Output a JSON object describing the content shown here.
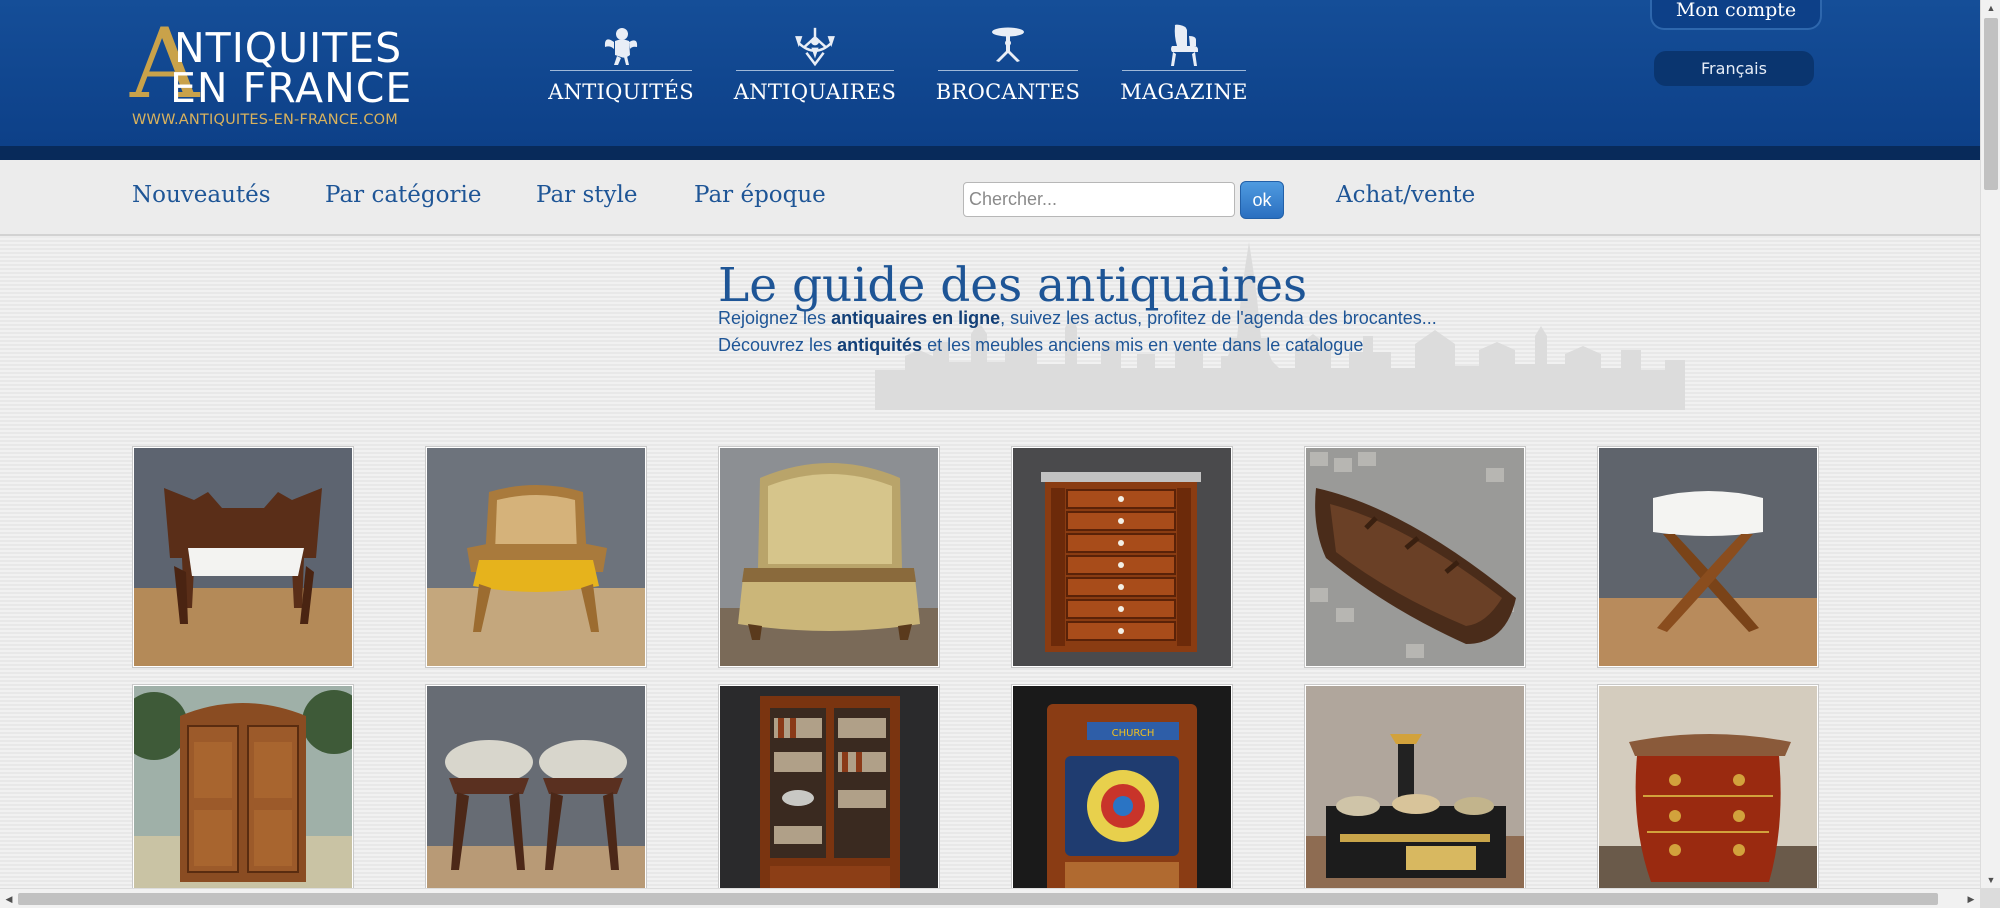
{
  "logo": {
    "line1": "NTIQUITES",
    "line2": "EN FRANCE",
    "big_letter": "A",
    "url": "WWW.ANTIQUITES-EN-FRANCE.COM"
  },
  "main_nav": [
    {
      "label": "ANTIQUITÉS",
      "icon": "cherub-icon"
    },
    {
      "label": "ANTIQUAIRES",
      "icon": "chandelier-icon"
    },
    {
      "label": "BROCANTES",
      "icon": "gueridon-icon"
    },
    {
      "label": "MAGAZINE",
      "icon": "armchair-icon"
    }
  ],
  "account": {
    "label": "Mon compte"
  },
  "language": {
    "label": "Français"
  },
  "subnav": {
    "links": [
      "Nouveautés",
      "Par catégorie",
      "Par style",
      "Par époque"
    ],
    "search_placeholder": "Chercher...",
    "search_button": "ok",
    "trade_link": "Achat/vente"
  },
  "guide": {
    "title": "Le guide des antiquaires",
    "line1": {
      "before": "Rejoignez les ",
      "bold": "antiquaires en ligne",
      "after": ", suivez les actus, profitez de l'agenda des brocantes..."
    },
    "line2": {
      "before": "Découvrez les ",
      "bold": "antiquités",
      "after": " et les meubles anciens mis en vente dans le catalogue"
    }
  },
  "products": [
    {
      "name": "carved-corner-chair",
      "subject": "corner chair"
    },
    {
      "name": "caned-armchair",
      "subject": "armchair"
    },
    {
      "name": "upholstered-bed",
      "subject": "bed"
    },
    {
      "name": "mahogany-chest-of-drawers",
      "subject": "chest"
    },
    {
      "name": "wooden-boat",
      "subject": "boat"
    },
    {
      "name": "curule-stool",
      "subject": "stool"
    },
    {
      "name": "rustic-armoire",
      "subject": "armoire"
    },
    {
      "name": "pair-of-stools",
      "subject": "stools"
    },
    {
      "name": "glazed-bookcase",
      "subject": "bookcase"
    },
    {
      "name": "arcade-pinball-machine",
      "subject": "pinball"
    },
    {
      "name": "antique-cooking-stove",
      "subject": "stove"
    },
    {
      "name": "marquetry-commode",
      "subject": "commode"
    }
  ],
  "colors": {
    "header_blue": "#154e98",
    "header_dark": "#082a5a",
    "link_blue": "#1e5596",
    "logo_gold": "#c9a24a",
    "button_blue": "#2a6fc0"
  }
}
